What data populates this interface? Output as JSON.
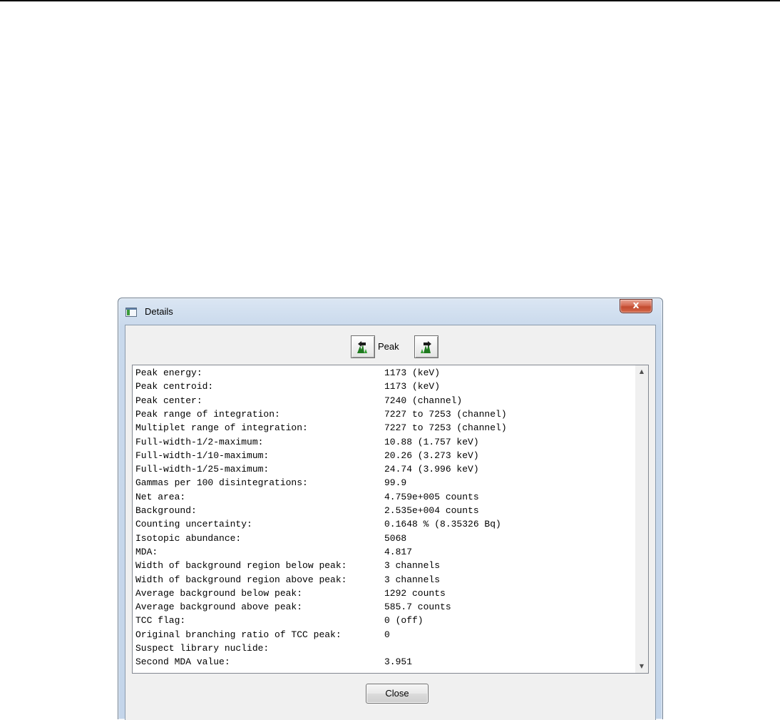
{
  "window": {
    "title": "Details",
    "close_glyph": "x"
  },
  "navigation": {
    "label": "Peak",
    "prev_icon": "previous-peak-icon",
    "next_icon": "next-peak-icon"
  },
  "details": [
    {
      "label": "Peak energy:",
      "value": "1173 (keV)"
    },
    {
      "label": "Peak centroid:",
      "value": "1173 (keV)"
    },
    {
      "label": "Peak center:",
      "value": "7240 (channel)"
    },
    {
      "label": "Peak range of integration:",
      "value": "7227 to 7253 (channel)"
    },
    {
      "label": "Multiplet range of integration:",
      "value": "7227 to 7253 (channel)"
    },
    {
      "label": "Full-width-1/2-maximum:",
      "value": "10.88 (1.757 keV)"
    },
    {
      "label": "Full-width-1/10-maximum:",
      "value": "20.26 (3.273 keV)"
    },
    {
      "label": "Full-width-1/25-maximum:",
      "value": "24.74 (3.996 keV)"
    },
    {
      "label": "Gammas per 100 disintegrations:",
      "value": "99.9"
    },
    {
      "label": "Net area:",
      "value": "4.759e+005 counts"
    },
    {
      "label": "Background:",
      "value": "2.535e+004 counts"
    },
    {
      "label": "Counting uncertainty:",
      "value": "0.1648 % (8.35326 Bq)"
    },
    {
      "label": "Isotopic abundance:",
      "value": "5068"
    },
    {
      "label": "MDA:",
      "value": "4.817"
    },
    {
      "label": "Width of background region below peak:",
      "value": "3 channels"
    },
    {
      "label": "Width of background region above peak:",
      "value": "3 channels"
    },
    {
      "label": "Average background below peak:",
      "value": "1292 counts"
    },
    {
      "label": "Average background above peak:",
      "value": "585.7 counts"
    },
    {
      "label": "TCC flag:",
      "value": "0 (off)"
    },
    {
      "label": "Original branching ratio of TCC peak:",
      "value": "0"
    },
    {
      "label": "Suspect library nuclide:",
      "value": ""
    },
    {
      "label": "Second MDA value:",
      "value": "3.951"
    }
  ],
  "scrollbar": {
    "up_glyph": "▲",
    "down_glyph": "▼"
  },
  "buttons": {
    "close_label": "Close"
  },
  "colors": {
    "icon_green": "#1f7a1f",
    "icon_dark": "#1a1a1a"
  }
}
